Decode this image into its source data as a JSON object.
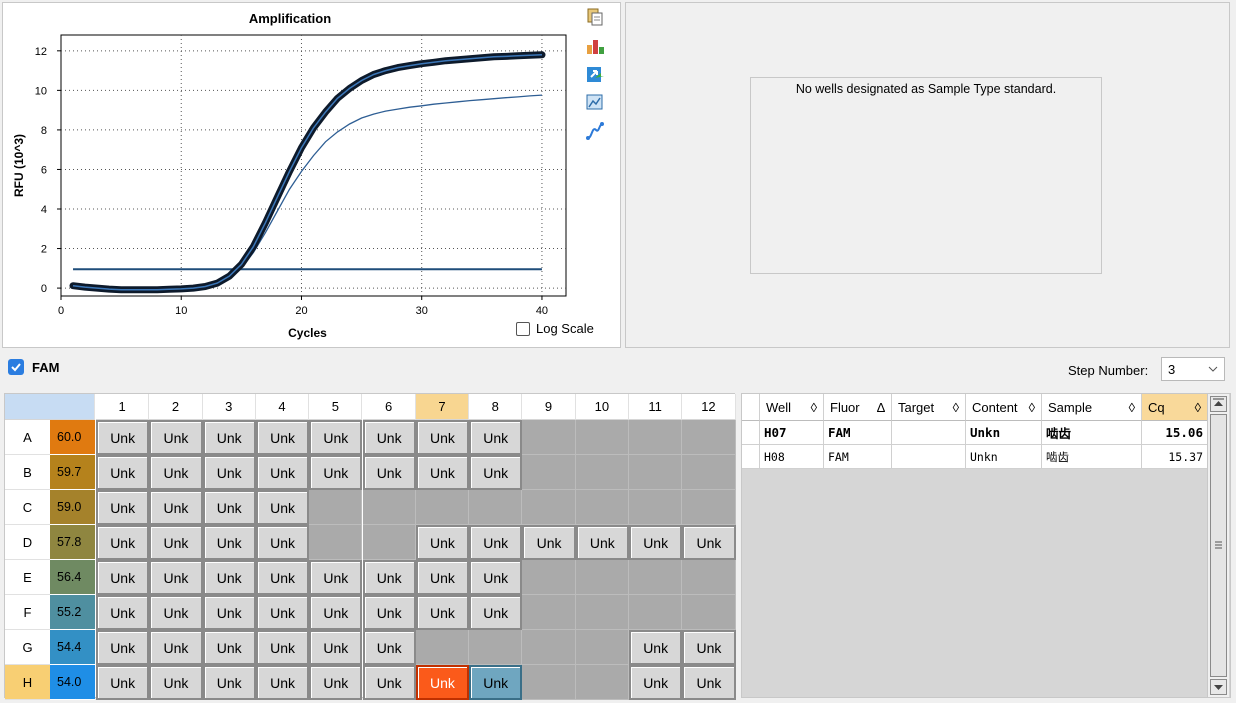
{
  "chart": {
    "title": "Amplification",
    "xlabel": "Cycles",
    "ylabel": "RFU (10^3)",
    "log_scale_label": "Log Scale",
    "toolbar_icons": [
      "copy-icon",
      "bar-chart-icon",
      "export-icon",
      "chart-settings-icon",
      "curve-icon"
    ]
  },
  "chart_data": {
    "type": "line",
    "title": "Amplification",
    "xlabel": "Cycles",
    "ylabel": "RFU (10^3)",
    "xlim": [
      0,
      42
    ],
    "ylim": [
      -0.4,
      12.8
    ],
    "xticks": [
      0,
      10,
      20,
      30,
      40
    ],
    "yticks": [
      0,
      2,
      4,
      6,
      8,
      10,
      12
    ],
    "grid": true,
    "threshold": 0.95,
    "series": [
      {
        "name": "H07",
        "style": "bold",
        "x": [
          1,
          2,
          3,
          4,
          5,
          6,
          7,
          8,
          9,
          10,
          11,
          12,
          13,
          14,
          15,
          16,
          17,
          18,
          19,
          20,
          21,
          22,
          23,
          24,
          25,
          26,
          27,
          28,
          29,
          30,
          31,
          32,
          33,
          34,
          35,
          36,
          37,
          38,
          39,
          40
        ],
        "values": [
          0.12,
          0.05,
          0,
          -0.05,
          -0.08,
          -0.08,
          -0.08,
          -0.08,
          -0.06,
          -0.04,
          0,
          0.08,
          0.25,
          0.6,
          1.2,
          2.1,
          3.3,
          4.6,
          5.9,
          7.1,
          8.1,
          8.9,
          9.6,
          10.1,
          10.5,
          10.8,
          11.0,
          11.15,
          11.25,
          11.35,
          11.42,
          11.5,
          11.55,
          11.6,
          11.65,
          11.7,
          11.72,
          11.75,
          11.78,
          11.8
        ]
      },
      {
        "name": "H08",
        "style": "thin",
        "x": [
          1,
          2,
          3,
          4,
          5,
          6,
          7,
          8,
          9,
          10,
          11,
          12,
          13,
          14,
          15,
          16,
          17,
          18,
          19,
          20,
          21,
          22,
          23,
          24,
          25,
          26,
          27,
          28,
          29,
          30,
          31,
          32,
          33,
          34,
          35,
          36,
          37,
          38,
          39,
          40
        ],
        "values": [
          0.1,
          0.03,
          0,
          -0.05,
          -0.08,
          -0.08,
          -0.08,
          -0.08,
          -0.06,
          -0.04,
          0,
          0.07,
          0.2,
          0.5,
          1.0,
          1.8,
          2.8,
          3.9,
          5.0,
          5.9,
          6.7,
          7.4,
          7.9,
          8.3,
          8.6,
          8.8,
          8.95,
          9.05,
          9.15,
          9.22,
          9.3,
          9.36,
          9.42,
          9.48,
          9.53,
          9.58,
          9.63,
          9.67,
          9.72,
          9.76
        ]
      }
    ]
  },
  "standard_curve": {
    "message": "No wells designated as Sample Type standard."
  },
  "fluor": {
    "label": "FAM",
    "checked": true
  },
  "step": {
    "label": "Step Number:",
    "value": "3"
  },
  "plate": {
    "columns": [
      "1",
      "2",
      "3",
      "4",
      "5",
      "6",
      "7",
      "8",
      "9",
      "10",
      "11",
      "12"
    ],
    "rows": [
      {
        "label": "A",
        "temp": "60.0",
        "color": "#e07a10",
        "wells": [
          "Unk",
          "Unk",
          "Unk",
          "Unk",
          "Unk",
          "Unk",
          "Unk",
          "Unk",
          "",
          "",
          "",
          ""
        ]
      },
      {
        "label": "B",
        "temp": "59.7",
        "color": "#b5821c",
        "wells": [
          "Unk",
          "Unk",
          "Unk",
          "Unk",
          "Unk",
          "Unk",
          "Unk",
          "Unk",
          "",
          "",
          "",
          ""
        ]
      },
      {
        "label": "C",
        "temp": "59.0",
        "color": "#a5822b",
        "wells": [
          "Unk",
          "Unk",
          "Unk",
          "Unk",
          "",
          "",
          "",
          "",
          "",
          "",
          "",
          ""
        ]
      },
      {
        "label": "D",
        "temp": "57.8",
        "color": "#8f8640",
        "wells": [
          "Unk",
          "Unk",
          "Unk",
          "Unk",
          "",
          "",
          "Unk",
          "Unk",
          "Unk",
          "Unk",
          "Unk",
          "Unk"
        ]
      },
      {
        "label": "E",
        "temp": "56.4",
        "color": "#6f8a62",
        "wells": [
          "Unk",
          "Unk",
          "Unk",
          "Unk",
          "Unk",
          "Unk",
          "Unk",
          "Unk",
          "",
          "",
          "",
          ""
        ]
      },
      {
        "label": "F",
        "temp": "55.2",
        "color": "#4f8fa0",
        "wells": [
          "Unk",
          "Unk",
          "Unk",
          "Unk",
          "Unk",
          "Unk",
          "Unk",
          "Unk",
          "",
          "",
          "",
          ""
        ]
      },
      {
        "label": "G",
        "temp": "54.4",
        "color": "#3390c5",
        "wells": [
          "Unk",
          "Unk",
          "Unk",
          "Unk",
          "Unk",
          "Unk",
          "",
          "",
          "",
          "",
          "Unk",
          "Unk"
        ]
      },
      {
        "label": "H",
        "temp": "54.0",
        "color": "#1f8ee6",
        "wells": [
          "Unk",
          "Unk",
          "Unk",
          "Unk",
          "Unk",
          "Unk",
          "Unk",
          "Unk",
          "",
          "",
          "Unk",
          "Unk"
        ]
      }
    ],
    "selected_row": "H",
    "selected_col": "7",
    "highlight_wells": {
      "H7": "selected",
      "H8": "secondary"
    }
  },
  "results": {
    "headers": [
      {
        "label": "Well",
        "sort": "◊"
      },
      {
        "label": "Fluor",
        "sort": "∆"
      },
      {
        "label": "Target",
        "sort": "◊"
      },
      {
        "label": "Content",
        "sort": "◊"
      },
      {
        "label": "Sample",
        "sort": "◊"
      },
      {
        "label": "Cq",
        "sort": "◊"
      }
    ],
    "rows": [
      {
        "well": "H07",
        "fluor": "FAM",
        "target": "",
        "content": "Unkn",
        "sample": "啮齿",
        "cq": "15.06",
        "bold": true
      },
      {
        "well": "H08",
        "fluor": "FAM",
        "target": "",
        "content": "Unkn",
        "sample": "啮齿",
        "cq": "15.37",
        "bold": false
      }
    ]
  }
}
